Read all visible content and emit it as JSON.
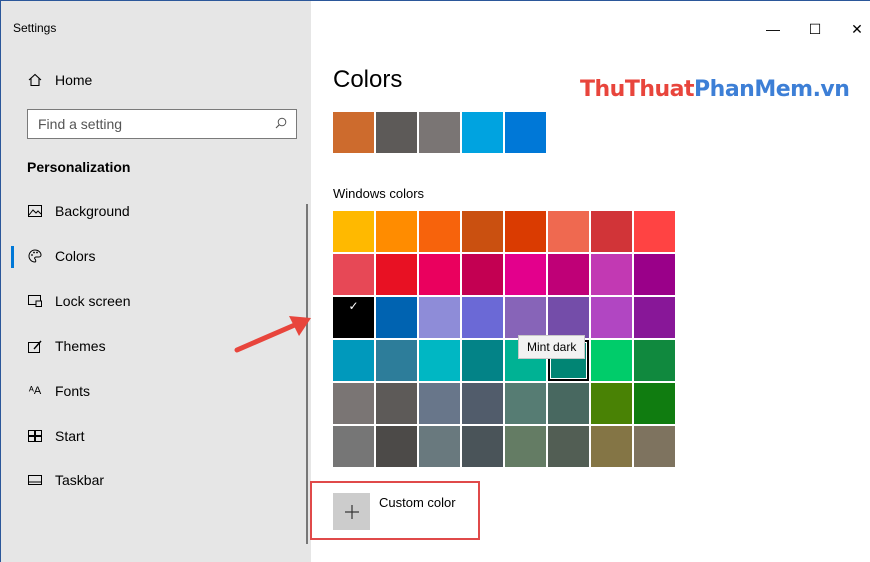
{
  "window": {
    "title": "Settings",
    "minimize_glyph": "—",
    "maximize_glyph": "☐",
    "close_glyph": "✕"
  },
  "sidebar": {
    "home": {
      "label": "Home",
      "icon": "home-icon"
    },
    "search": {
      "placeholder": "Find a setting",
      "icon": "search-icon"
    },
    "section_title": "Personalization",
    "items": [
      {
        "label": "Background",
        "icon": "background-icon",
        "active": false
      },
      {
        "label": "Colors",
        "icon": "palette-icon",
        "active": true
      },
      {
        "label": "Lock screen",
        "icon": "lock-screen-icon",
        "active": false
      },
      {
        "label": "Themes",
        "icon": "themes-icon",
        "active": false
      },
      {
        "label": "Fonts",
        "icon": "fonts-icon",
        "active": false
      },
      {
        "label": "Start",
        "icon": "start-icon",
        "active": false
      },
      {
        "label": "Taskbar",
        "icon": "taskbar-icon",
        "active": false
      }
    ]
  },
  "main": {
    "title": "Colors",
    "watermark": {
      "part1": "ThuThuat",
      "part2": "PhanMem",
      "part3": ".vn"
    },
    "recent_colors": [
      "#cd6b2d",
      "#5d5a58",
      "#7a7574",
      "#00a3e0",
      "#0078d7"
    ],
    "windows_colors_label": "Windows colors",
    "windows_colors": [
      [
        "#ffb900",
        "#ff8c00",
        "#f7630c",
        "#ca5010",
        "#da3b01",
        "#ef6950",
        "#d13438",
        "#ff4343"
      ],
      [
        "#e74856",
        "#e81123",
        "#ea005e",
        "#c30052",
        "#e3008c",
        "#bf0077",
        "#c239b3",
        "#9a0089"
      ],
      [
        "#0078d7",
        "#0063b1",
        "#8e8cd8",
        "#6b69d6",
        "#8764b8",
        "#744da9",
        "#b146c2",
        "#881798"
      ],
      [
        "#0099bc",
        "#2d7d9a",
        "#00b7c3",
        "#038387",
        "#00b294",
        "#018574",
        "#00cc6a",
        "#10893e"
      ],
      [
        "#7a7574",
        "#5d5a58",
        "#68768a",
        "#515c6b",
        "#567c73",
        "#486860",
        "#498205",
        "#107c10"
      ],
      [
        "#767676",
        "#4c4a48",
        "#69797e",
        "#4a5459",
        "#647c64",
        "#525e54",
        "#847545",
        "#7e735f"
      ]
    ],
    "selected_color": "#0078d7",
    "tooltip": "Mint dark",
    "custom_color_label": "Custom color"
  },
  "annotation": {
    "box_color": "#e04a4a",
    "arrow_color": "#e8453c"
  }
}
